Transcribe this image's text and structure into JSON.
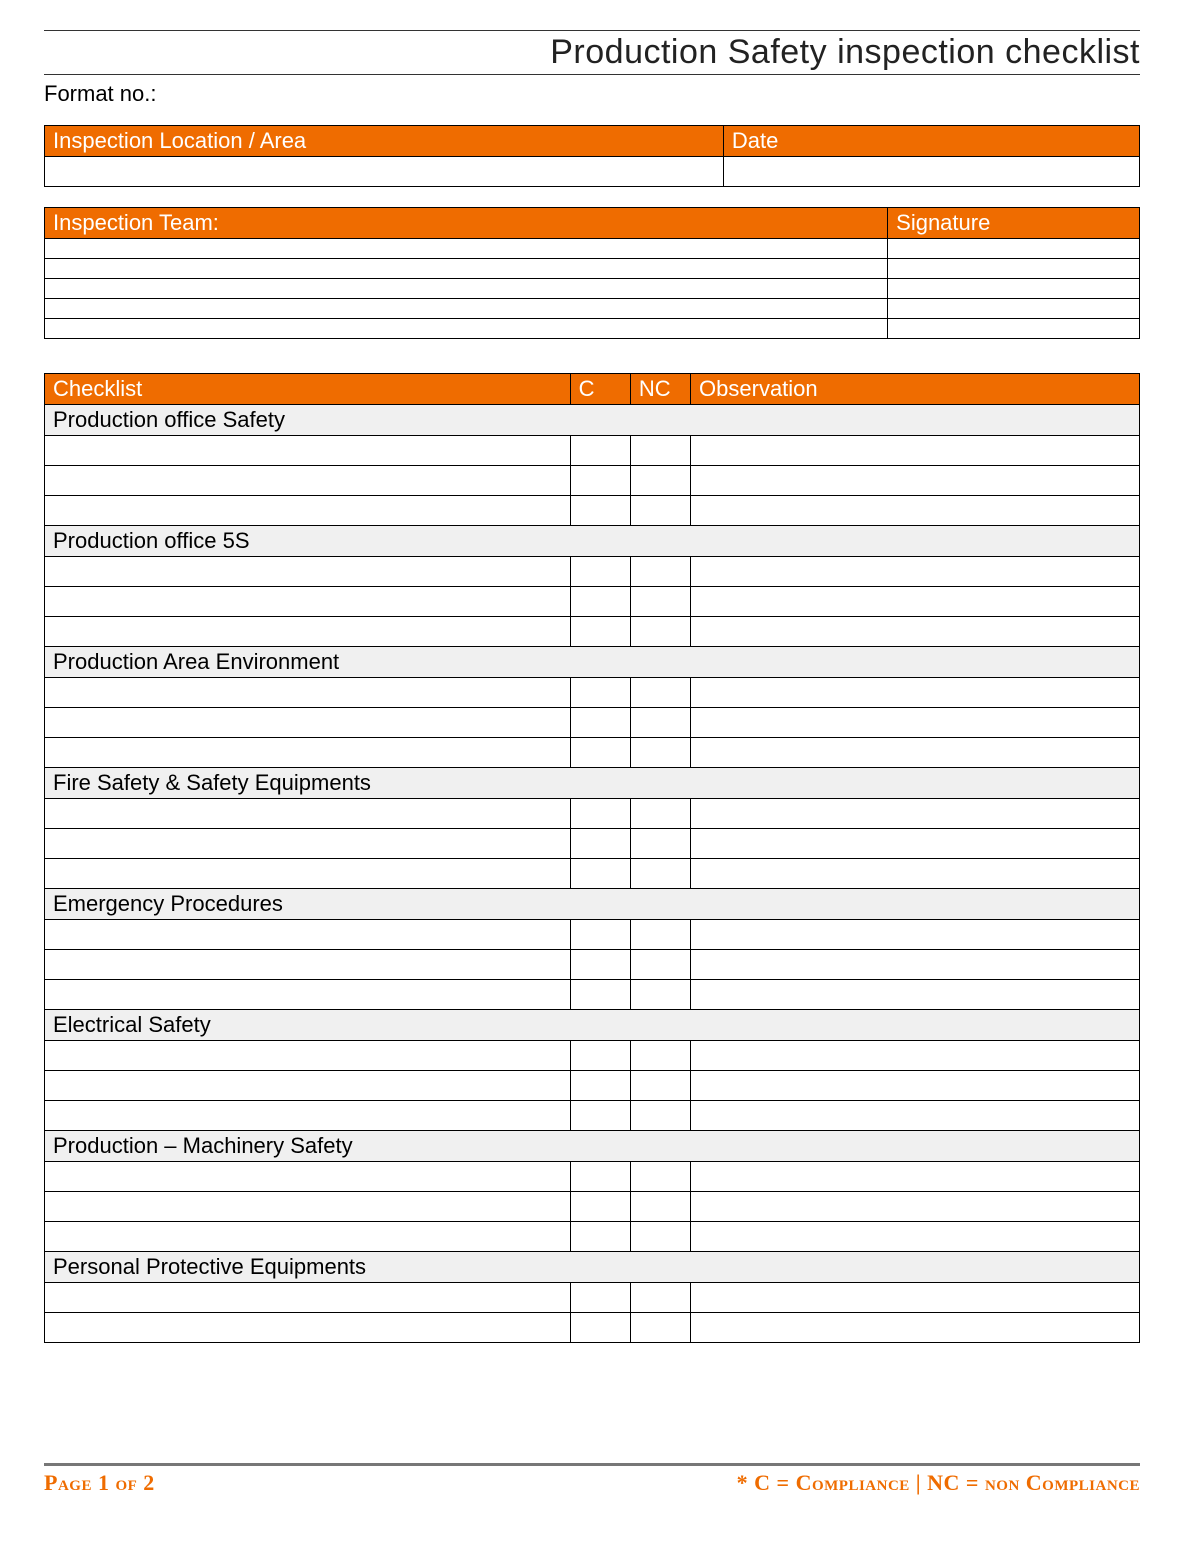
{
  "header": {
    "title": "Production Safety inspection checklist",
    "format_no_label": "Format no.:"
  },
  "meta1": {
    "location_label": "Inspection Location / Area",
    "date_label": "Date",
    "location_value": "",
    "date_value": ""
  },
  "meta2": {
    "team_label": "Inspection Team:",
    "signature_label": "Signature",
    "rows": [
      {
        "name": "",
        "sig": ""
      },
      {
        "name": "",
        "sig": ""
      },
      {
        "name": "",
        "sig": ""
      },
      {
        "name": "",
        "sig": ""
      },
      {
        "name": "",
        "sig": ""
      }
    ]
  },
  "checklist": {
    "headers": {
      "item": "Checklist",
      "c": "C",
      "nc": "NC",
      "obs": "Observation"
    },
    "sections": [
      {
        "title": "Production office Safety",
        "rows": [
          {
            "c": "",
            "nc": "",
            "obs": ""
          },
          {
            "c": "",
            "nc": "",
            "obs": ""
          },
          {
            "c": "",
            "nc": "",
            "obs": ""
          }
        ]
      },
      {
        "title": "Production office 5S",
        "rows": [
          {
            "c": "",
            "nc": "",
            "obs": ""
          },
          {
            "c": "",
            "nc": "",
            "obs": ""
          },
          {
            "c": "",
            "nc": "",
            "obs": ""
          }
        ]
      },
      {
        "title": "Production Area Environment",
        "rows": [
          {
            "c": "",
            "nc": "",
            "obs": ""
          },
          {
            "c": "",
            "nc": "",
            "obs": ""
          },
          {
            "c": "",
            "nc": "",
            "obs": ""
          }
        ]
      },
      {
        "title": "Fire Safety & Safety Equipments",
        "rows": [
          {
            "c": "",
            "nc": "",
            "obs": ""
          },
          {
            "c": "",
            "nc": "",
            "obs": ""
          },
          {
            "c": "",
            "nc": "",
            "obs": ""
          }
        ]
      },
      {
        "title": "Emergency Procedures",
        "rows": [
          {
            "c": "",
            "nc": "",
            "obs": ""
          },
          {
            "c": "",
            "nc": "",
            "obs": ""
          },
          {
            "c": "",
            "nc": "",
            "obs": ""
          }
        ]
      },
      {
        "title": "Electrical Safety",
        "rows": [
          {
            "c": "",
            "nc": "",
            "obs": ""
          },
          {
            "c": "",
            "nc": "",
            "obs": ""
          },
          {
            "c": "",
            "nc": "",
            "obs": ""
          }
        ]
      },
      {
        "title": "Production – Machinery Safety",
        "rows": [
          {
            "c": "",
            "nc": "",
            "obs": ""
          },
          {
            "c": "",
            "nc": "",
            "obs": ""
          },
          {
            "c": "",
            "nc": "",
            "obs": ""
          }
        ]
      },
      {
        "title": "Personal Protective Equipments",
        "rows": [
          {
            "c": "",
            "nc": "",
            "obs": ""
          },
          {
            "c": "",
            "nc": "",
            "obs": ""
          }
        ]
      }
    ]
  },
  "footer": {
    "page": "Page 1 of 2",
    "legend": "* C = Compliance | NC = non Compliance"
  }
}
